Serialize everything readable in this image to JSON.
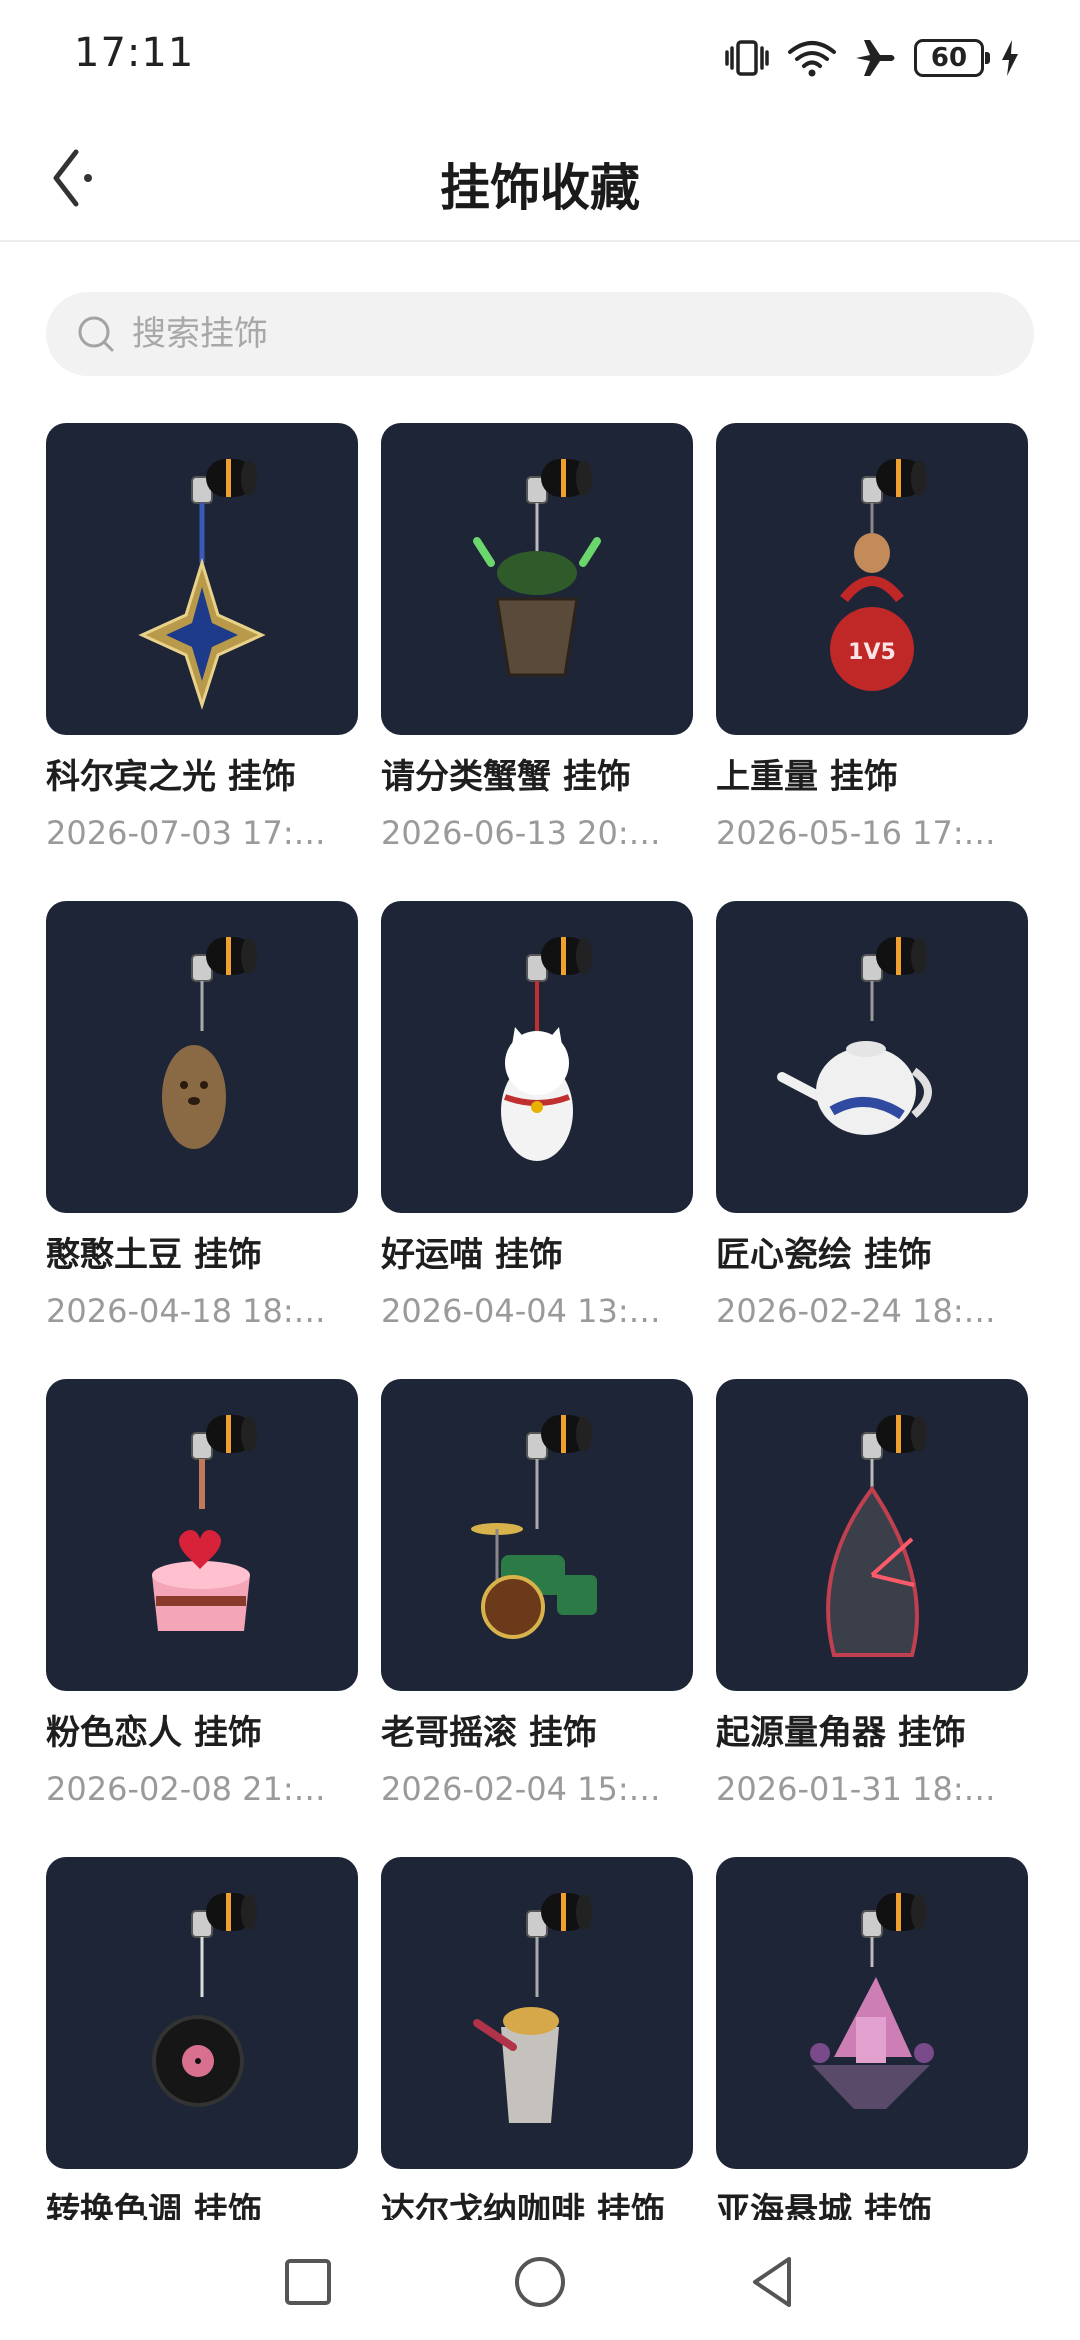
{
  "status_bar": {
    "time": "17:11",
    "battery": "60",
    "icons": [
      "vibrate-icon",
      "wifi-icon",
      "airplane-icon",
      "battery-icon",
      "charging-icon"
    ]
  },
  "header": {
    "title": "挂饰收藏",
    "back_icon": "back-arrow-icon"
  },
  "search": {
    "placeholder": "搜索挂饰",
    "value": ""
  },
  "items": [
    {
      "name": "科尔宾之光 挂饰",
      "date": "2026-07-03 17:…",
      "art": "star"
    },
    {
      "name": "请分类蟹蟹 挂饰",
      "date": "2026-06-13 20:…",
      "art": "basket"
    },
    {
      "name": "上重量 挂饰",
      "date": "2026-05-16 17:…",
      "art": "kettlebell",
      "badge": "1V5"
    },
    {
      "name": "憨憨土豆 挂饰",
      "date": "2026-04-18 18:…",
      "art": "potato"
    },
    {
      "name": "好运喵 挂饰",
      "date": "2026-04-04 13:…",
      "art": "cat"
    },
    {
      "name": "匠心瓷绘 挂饰",
      "date": "2026-02-24 18:…",
      "art": "teapot"
    },
    {
      "name": "粉色恋人 挂饰",
      "date": "2026-02-08 21:…",
      "art": "cake"
    },
    {
      "name": "老哥摇滚 挂饰",
      "date": "2026-02-04 15:…",
      "art": "drums"
    },
    {
      "name": "起源量角器 挂饰",
      "date": "2026-01-31 18:…",
      "art": "protractor"
    },
    {
      "name": "转换色调 挂饰",
      "date": "",
      "art": "vinyl"
    },
    {
      "name": "达尔戈纳咖啡 挂饰",
      "date": "",
      "art": "coffee"
    },
    {
      "name": "亚海悬城 挂饰",
      "date": "",
      "art": "island"
    }
  ],
  "nav": {
    "recents_icon": "square-icon",
    "home_icon": "circle-icon",
    "back_icon": "triangle-back-icon"
  },
  "colors": {
    "card_bg": "#1d2537",
    "accent_orange": "#f0a030"
  }
}
